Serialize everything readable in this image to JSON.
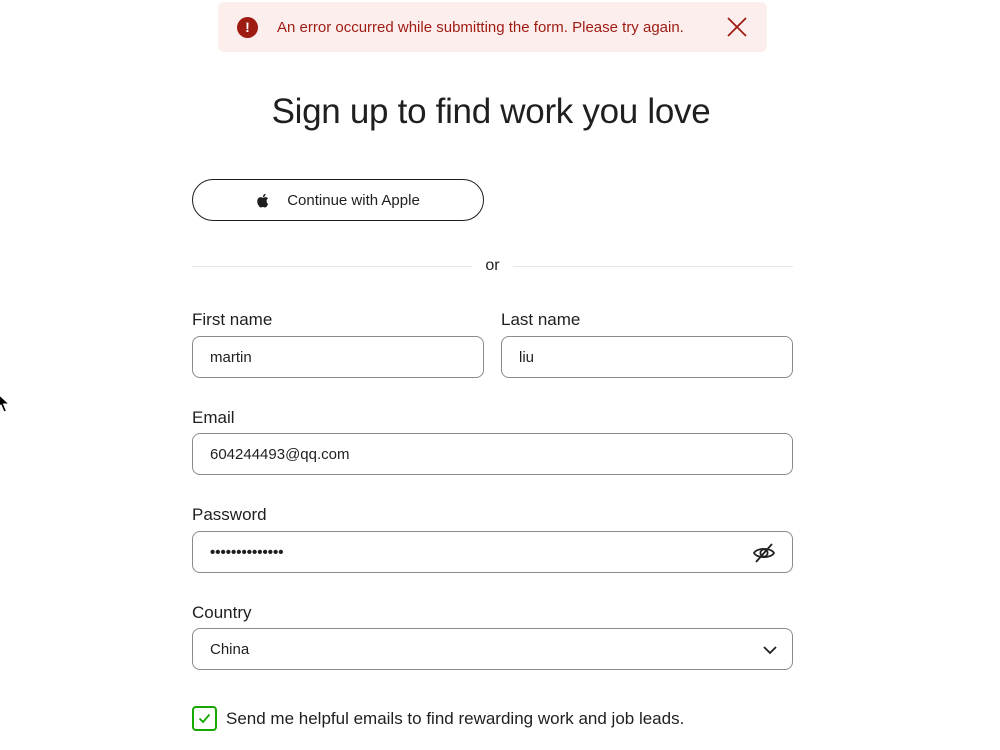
{
  "error_banner": {
    "icon": "!",
    "message": "An error occurred while submitting the form. Please try again.",
    "color": "#9e1b12",
    "background": "#fdeeee"
  },
  "title": "Sign up to find work you love",
  "apple_button": {
    "label": "Continue with Apple",
    "icon": "apple-icon"
  },
  "divider_text": "or",
  "first_name": {
    "label": "First name",
    "value": "martin"
  },
  "last_name": {
    "label": "Last name",
    "value": "liu"
  },
  "email": {
    "label": "Email",
    "value": "604244493@qq.com"
  },
  "password": {
    "label": "Password",
    "masked_value": "••••••••••••••",
    "toggle_icon": "eye-slash-icon"
  },
  "country": {
    "label": "Country",
    "value": "China",
    "icon": "chevron-down-icon"
  },
  "marketing_opt_in": {
    "label": "Send me helpful emails to find rewarding work and job leads.",
    "checked": true,
    "color": "#14a800"
  }
}
